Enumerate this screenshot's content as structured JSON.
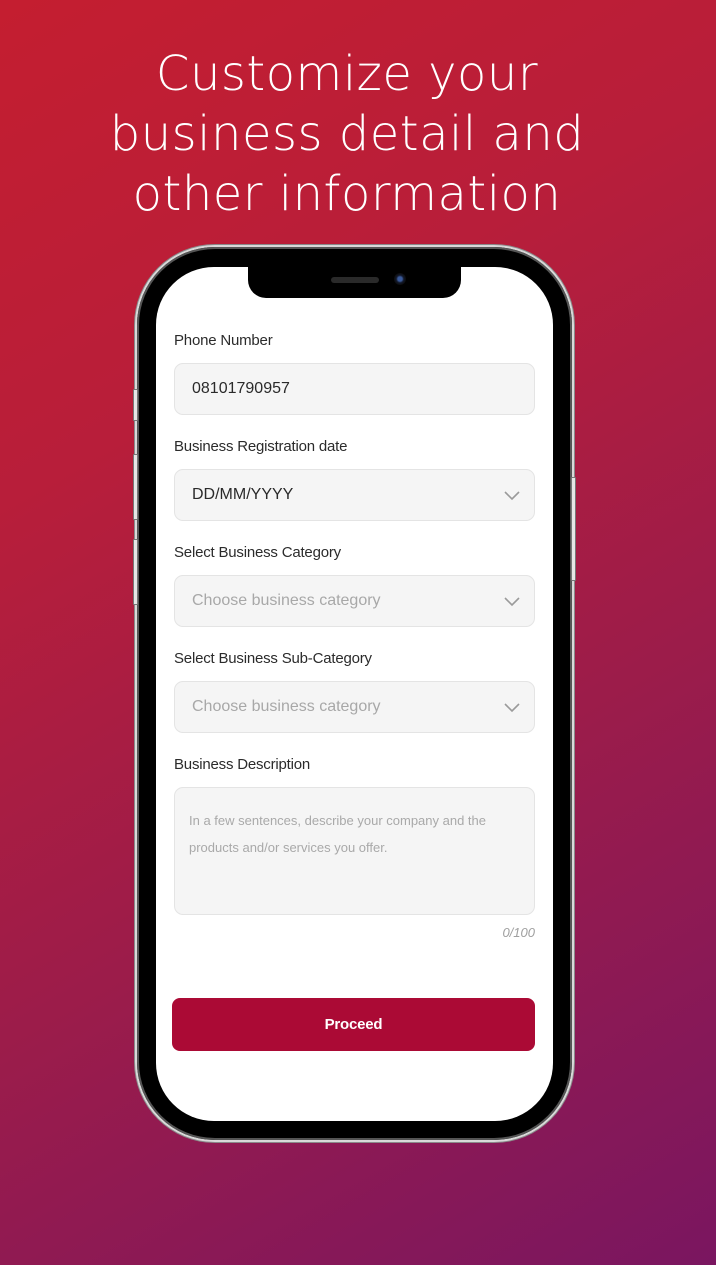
{
  "headline": {
    "lines": [
      "Customize your",
      "business detail and",
      "other information"
    ]
  },
  "form": {
    "phone": {
      "label": "Phone Number",
      "value": "08101790957"
    },
    "registration_date": {
      "label": "Business Registration date",
      "value": "DD/MM/YYYY",
      "icon": "chevron-down-icon"
    },
    "category": {
      "label": "Select Business Category",
      "placeholder": "Choose business category",
      "icon": "chevron-down-icon"
    },
    "sub_category": {
      "label": "Select Business Sub-Category",
      "placeholder": "Choose business category",
      "icon": "chevron-down-icon"
    },
    "description": {
      "label": "Business Description",
      "placeholder": "In a few sentences, describe your company and the products and/or services you offer.",
      "counter": "0/100"
    },
    "proceed_label": "Proceed"
  },
  "colors": {
    "background_start": "#c41e30",
    "background_end": "#7a1660",
    "primary_button": "#ab0a35",
    "field_background": "#f5f5f5",
    "placeholder_text": "#a8a8a8"
  }
}
